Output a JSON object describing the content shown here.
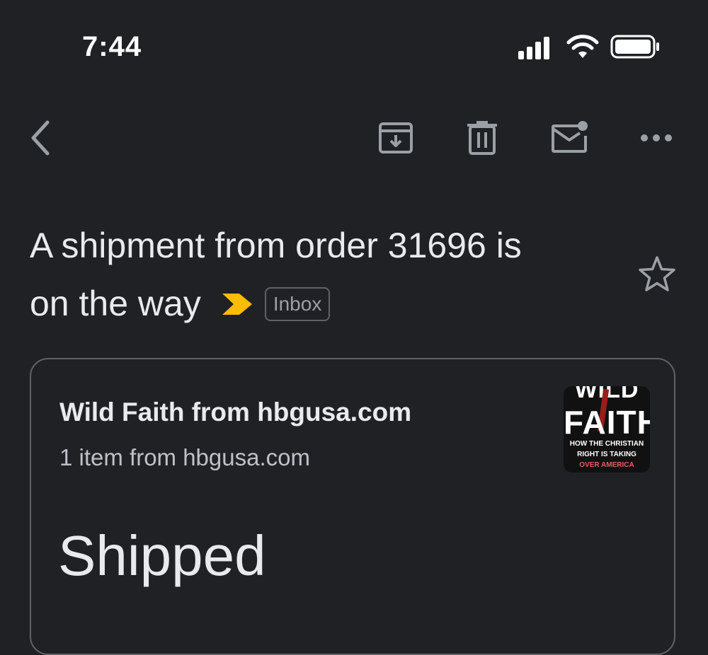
{
  "status_bar": {
    "time": "7:44"
  },
  "toolbar": {
    "back_icon": "chevron-left-icon",
    "archive_icon": "archive-icon",
    "delete_icon": "trash-icon",
    "mark_unread_icon": "mail-unread-icon",
    "more_icon": "more-horizontal-icon"
  },
  "email": {
    "subject_line1": "A shipment from order 31696 is",
    "subject_line2": "on the way",
    "label": "Inbox",
    "importance_color": "#fbbc04"
  },
  "order_card": {
    "title": "Wild Faith from hbgusa.com",
    "subtitle": "1 item from hbgusa.com",
    "status": "Shipped",
    "book_cover": {
      "title_top": "WILD",
      "title_main": "FAITH",
      "line1": "HOW THE CHRISTIAN",
      "line2": "RIGHT IS TAKING",
      "line3": "OVER AMERICA"
    }
  },
  "colors": {
    "background": "#202124",
    "text": "#e8eaed",
    "icon": "#9aa0a6",
    "border": "#5f6368"
  }
}
